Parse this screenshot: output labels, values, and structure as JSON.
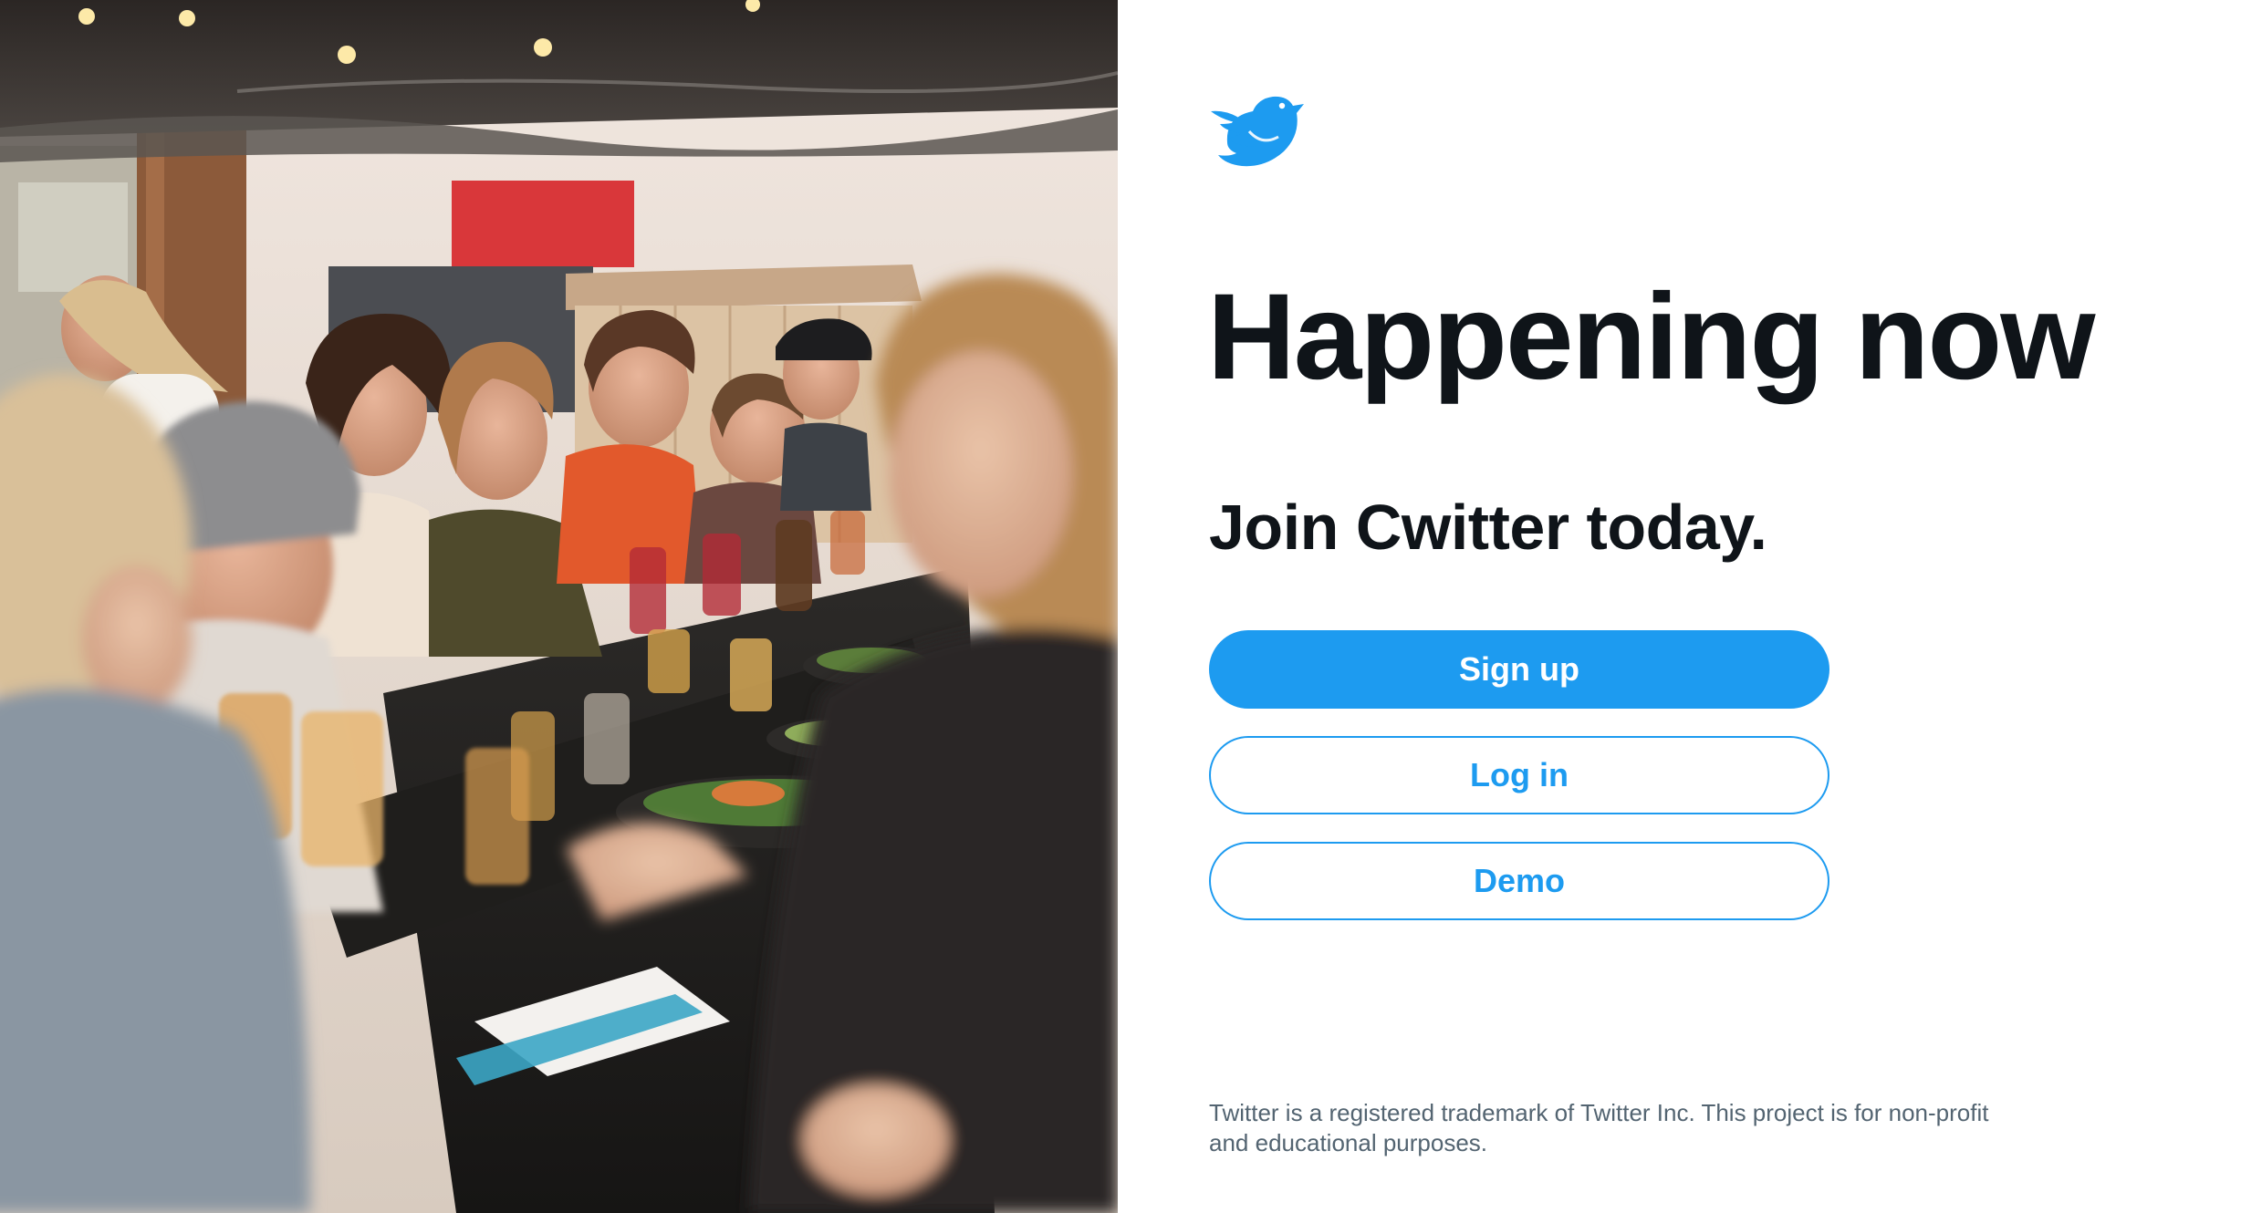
{
  "hero": {
    "image_alt": "People dining together at a long outdoor table"
  },
  "logo": {
    "icon": "bird-icon",
    "color": "#1d9bf0"
  },
  "headline": "Happening now",
  "subhead": "Join Cwitter today.",
  "buttons": {
    "signup_label": "Sign up",
    "login_label": "Log in",
    "demo_label": "Demo"
  },
  "footer": {
    "note": "Twitter is a registered trademark of Twitter Inc. This project is for non-profit and educational purposes."
  },
  "colors": {
    "accent": "#1d9bf0",
    "text_primary": "#0f1419",
    "text_secondary": "#536471"
  }
}
